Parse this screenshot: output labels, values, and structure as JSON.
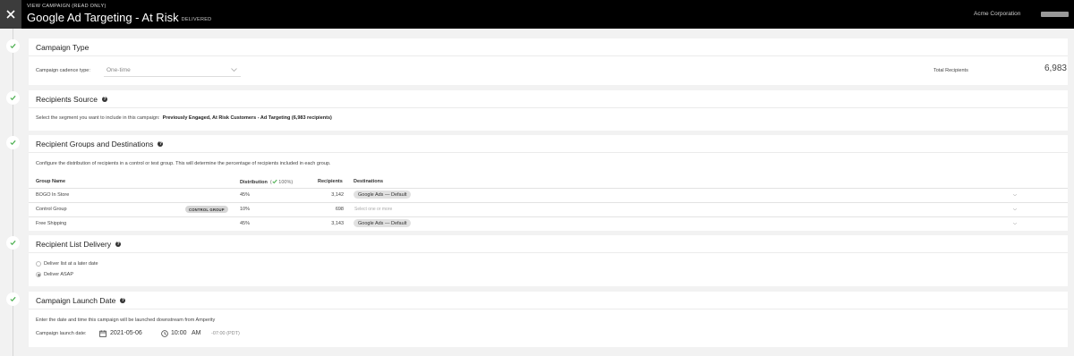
{
  "header": {
    "subtitle": "VIEW CAMPAIGN (READ ONLY)",
    "title": "Google Ad Targeting - At Risk",
    "status": "DELIVERED",
    "organization": "Acme Corporation"
  },
  "campaign_type": {
    "heading": "Campaign Type",
    "cadence_label": "Campaign cadence type:",
    "cadence_value": "One-time"
  },
  "recipients_source": {
    "heading": "Recipients Source",
    "prompt": "Select the segment you want to include in this campaign:",
    "segment": "Previously Engaged, At Risk Customers - Ad Targeting (6,983 recipients)",
    "total_label": "Total Recipients",
    "total_value": "6,983"
  },
  "recipient_groups": {
    "heading": "Recipient Groups and Destinations",
    "description": "Configure the distribution of recipients in a control or test group. This will determine the percentage of recipients included in each group.",
    "columns": {
      "group_name": "Group Name",
      "distribution": "Distribution",
      "distribution_total": "100%",
      "recipients": "Recipients",
      "destinations": "Destinations"
    },
    "rows": [
      {
        "name": "BOGO In Store",
        "badge": "",
        "distribution": "45%",
        "recipients": "3,142",
        "destination": "Google Ads — Default",
        "placeholder": ""
      },
      {
        "name": "Control Group",
        "badge": "CONTROL GROUP",
        "distribution": "10%",
        "recipients": "698",
        "destination": "",
        "placeholder": "Select one or more"
      },
      {
        "name": "Free Shipping",
        "badge": "",
        "distribution": "45%",
        "recipients": "3,143",
        "destination": "Google Ads — Default",
        "placeholder": ""
      }
    ]
  },
  "list_delivery": {
    "heading": "Recipient List Delivery",
    "option_later": "Deliver list at a later date",
    "option_asap": "Deliver ASAP",
    "selected": "asap"
  },
  "launch_date": {
    "heading": "Campaign Launch Date",
    "description": "Enter the date and time this campaign will be launched downstream from Amperity",
    "label": "Campaign launch date:",
    "date": "2021-05-06",
    "time": "10:00",
    "ampm": "AM",
    "timezone": "-07:00 (PDT)"
  },
  "icons": [
    "close-icon",
    "check-icon",
    "help-icon",
    "chevron-down-icon",
    "calendar-icon",
    "clock-icon"
  ],
  "colors": {
    "header_bg": "#000000",
    "accent_check": "#4caf50",
    "pill_bg": "#e1e1e1"
  }
}
